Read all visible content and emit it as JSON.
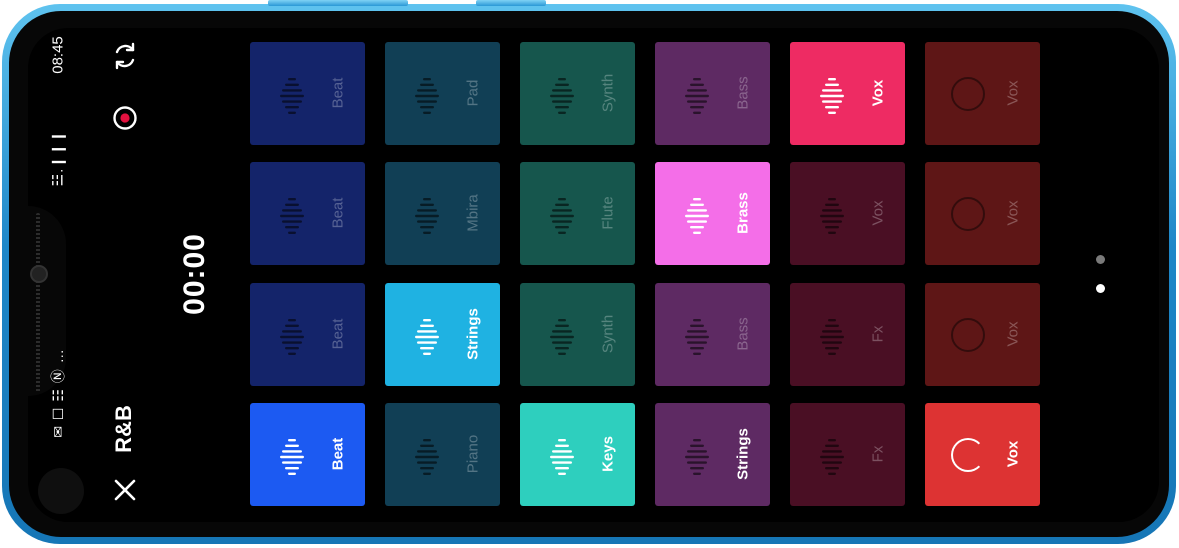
{
  "status_bar": {
    "time": "08:45",
    "icons": "✉ ☐ ☷ Ⓝ …",
    "signal": "☳.❙❙❙"
  },
  "header": {
    "title": "R&B",
    "timer": "00:00"
  },
  "icons": {
    "close": "close-icon",
    "record": "record-icon",
    "sync": "sync-icon"
  },
  "colors": {
    "beat": "#14246a",
    "beat_active": "#1c5af2",
    "teal_dark": "#113f55",
    "teal_active": "#1fb2e2",
    "green_dark": "#16564d",
    "keys_active": "#2ecfbe",
    "purple": "#5e2a63",
    "brass_active": "#f46ee8",
    "maroon": "#4a0f24",
    "vox_active": "#ee2b63",
    "red_dark": "#5e1616",
    "vox_red_active": "#dd3333"
  },
  "pads": [
    [
      {
        "label": "Beat",
        "state": "off",
        "color": "#14246a"
      },
      {
        "label": "Beat",
        "state": "off",
        "color": "#14246a"
      },
      {
        "label": "Beat",
        "state": "off",
        "color": "#14246a"
      },
      {
        "label": "Beat",
        "state": "on",
        "color": "#1c5af2"
      }
    ],
    [
      {
        "label": "Pad",
        "state": "off",
        "color": "#113f55"
      },
      {
        "label": "Mbira",
        "state": "off",
        "color": "#113f55"
      },
      {
        "label": "Strings",
        "state": "on",
        "color": "#1fb2e2"
      },
      {
        "label": "Piano",
        "state": "off",
        "color": "#113f55"
      }
    ],
    [
      {
        "label": "Synth",
        "state": "off",
        "color": "#16564d"
      },
      {
        "label": "Flute",
        "state": "off",
        "color": "#16564d"
      },
      {
        "label": "Synth",
        "state": "off",
        "color": "#16564d"
      },
      {
        "label": "Keys",
        "state": "on",
        "color": "#2ecfbe"
      }
    ],
    [
      {
        "label": "Bass",
        "state": "off",
        "color": "#5e2a63"
      },
      {
        "label": "Brass",
        "state": "on",
        "color": "#f46ee8"
      },
      {
        "label": "Bass",
        "state": "off",
        "color": "#5e2a63"
      },
      {
        "label": "Strings",
        "state": "off-bright",
        "color": "#5e2a63"
      }
    ],
    [
      {
        "label": "Vox",
        "state": "on",
        "color": "#ee2b63"
      },
      {
        "label": "Vox",
        "state": "off",
        "color": "#4a0f24"
      },
      {
        "label": "Fx",
        "state": "off",
        "color": "#4a0f24"
      },
      {
        "label": "Fx",
        "state": "off",
        "color": "#4a0f24"
      }
    ],
    [
      {
        "label": "Vox",
        "state": "ring",
        "color": "#5e1616"
      },
      {
        "label": "Vox",
        "state": "ring",
        "color": "#5e1616"
      },
      {
        "label": "Vox",
        "state": "ring",
        "color": "#5e1616"
      },
      {
        "label": "Vox",
        "state": "on-ring",
        "color": "#dd3333"
      }
    ]
  ],
  "page_indicator": {
    "total": 2,
    "current": 2
  }
}
